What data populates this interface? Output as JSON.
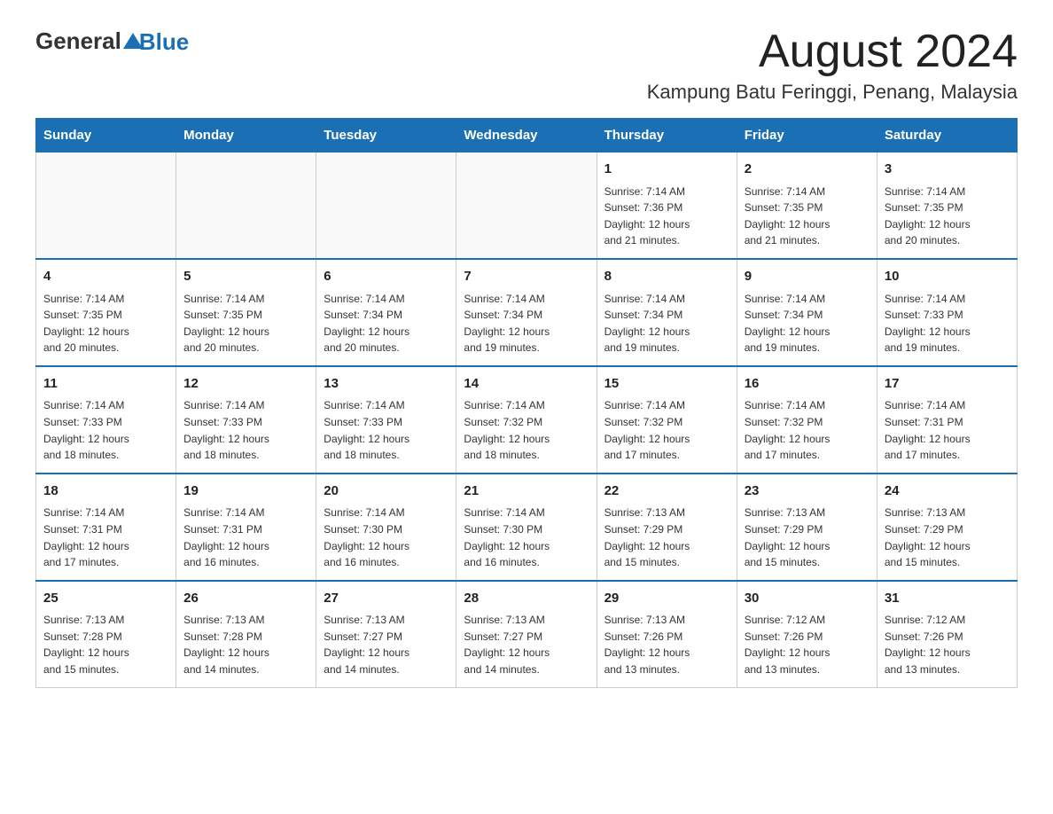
{
  "header": {
    "logo": {
      "text_general": "General",
      "text_blue": "Blue"
    },
    "month_year": "August 2024",
    "location": "Kampung Batu Feringgi, Penang, Malaysia"
  },
  "weekdays": [
    "Sunday",
    "Monday",
    "Tuesday",
    "Wednesday",
    "Thursday",
    "Friday",
    "Saturday"
  ],
  "weeks": [
    [
      {
        "day": "",
        "info": ""
      },
      {
        "day": "",
        "info": ""
      },
      {
        "day": "",
        "info": ""
      },
      {
        "day": "",
        "info": ""
      },
      {
        "day": "1",
        "info": "Sunrise: 7:14 AM\nSunset: 7:36 PM\nDaylight: 12 hours\nand 21 minutes."
      },
      {
        "day": "2",
        "info": "Sunrise: 7:14 AM\nSunset: 7:35 PM\nDaylight: 12 hours\nand 21 minutes."
      },
      {
        "day": "3",
        "info": "Sunrise: 7:14 AM\nSunset: 7:35 PM\nDaylight: 12 hours\nand 20 minutes."
      }
    ],
    [
      {
        "day": "4",
        "info": "Sunrise: 7:14 AM\nSunset: 7:35 PM\nDaylight: 12 hours\nand 20 minutes."
      },
      {
        "day": "5",
        "info": "Sunrise: 7:14 AM\nSunset: 7:35 PM\nDaylight: 12 hours\nand 20 minutes."
      },
      {
        "day": "6",
        "info": "Sunrise: 7:14 AM\nSunset: 7:34 PM\nDaylight: 12 hours\nand 20 minutes."
      },
      {
        "day": "7",
        "info": "Sunrise: 7:14 AM\nSunset: 7:34 PM\nDaylight: 12 hours\nand 19 minutes."
      },
      {
        "day": "8",
        "info": "Sunrise: 7:14 AM\nSunset: 7:34 PM\nDaylight: 12 hours\nand 19 minutes."
      },
      {
        "day": "9",
        "info": "Sunrise: 7:14 AM\nSunset: 7:34 PM\nDaylight: 12 hours\nand 19 minutes."
      },
      {
        "day": "10",
        "info": "Sunrise: 7:14 AM\nSunset: 7:33 PM\nDaylight: 12 hours\nand 19 minutes."
      }
    ],
    [
      {
        "day": "11",
        "info": "Sunrise: 7:14 AM\nSunset: 7:33 PM\nDaylight: 12 hours\nand 18 minutes."
      },
      {
        "day": "12",
        "info": "Sunrise: 7:14 AM\nSunset: 7:33 PM\nDaylight: 12 hours\nand 18 minutes."
      },
      {
        "day": "13",
        "info": "Sunrise: 7:14 AM\nSunset: 7:33 PM\nDaylight: 12 hours\nand 18 minutes."
      },
      {
        "day": "14",
        "info": "Sunrise: 7:14 AM\nSunset: 7:32 PM\nDaylight: 12 hours\nand 18 minutes."
      },
      {
        "day": "15",
        "info": "Sunrise: 7:14 AM\nSunset: 7:32 PM\nDaylight: 12 hours\nand 17 minutes."
      },
      {
        "day": "16",
        "info": "Sunrise: 7:14 AM\nSunset: 7:32 PM\nDaylight: 12 hours\nand 17 minutes."
      },
      {
        "day": "17",
        "info": "Sunrise: 7:14 AM\nSunset: 7:31 PM\nDaylight: 12 hours\nand 17 minutes."
      }
    ],
    [
      {
        "day": "18",
        "info": "Sunrise: 7:14 AM\nSunset: 7:31 PM\nDaylight: 12 hours\nand 17 minutes."
      },
      {
        "day": "19",
        "info": "Sunrise: 7:14 AM\nSunset: 7:31 PM\nDaylight: 12 hours\nand 16 minutes."
      },
      {
        "day": "20",
        "info": "Sunrise: 7:14 AM\nSunset: 7:30 PM\nDaylight: 12 hours\nand 16 minutes."
      },
      {
        "day": "21",
        "info": "Sunrise: 7:14 AM\nSunset: 7:30 PM\nDaylight: 12 hours\nand 16 minutes."
      },
      {
        "day": "22",
        "info": "Sunrise: 7:13 AM\nSunset: 7:29 PM\nDaylight: 12 hours\nand 15 minutes."
      },
      {
        "day": "23",
        "info": "Sunrise: 7:13 AM\nSunset: 7:29 PM\nDaylight: 12 hours\nand 15 minutes."
      },
      {
        "day": "24",
        "info": "Sunrise: 7:13 AM\nSunset: 7:29 PM\nDaylight: 12 hours\nand 15 minutes."
      }
    ],
    [
      {
        "day": "25",
        "info": "Sunrise: 7:13 AM\nSunset: 7:28 PM\nDaylight: 12 hours\nand 15 minutes."
      },
      {
        "day": "26",
        "info": "Sunrise: 7:13 AM\nSunset: 7:28 PM\nDaylight: 12 hours\nand 14 minutes."
      },
      {
        "day": "27",
        "info": "Sunrise: 7:13 AM\nSunset: 7:27 PM\nDaylight: 12 hours\nand 14 minutes."
      },
      {
        "day": "28",
        "info": "Sunrise: 7:13 AM\nSunset: 7:27 PM\nDaylight: 12 hours\nand 14 minutes."
      },
      {
        "day": "29",
        "info": "Sunrise: 7:13 AM\nSunset: 7:26 PM\nDaylight: 12 hours\nand 13 minutes."
      },
      {
        "day": "30",
        "info": "Sunrise: 7:12 AM\nSunset: 7:26 PM\nDaylight: 12 hours\nand 13 minutes."
      },
      {
        "day": "31",
        "info": "Sunrise: 7:12 AM\nSunset: 7:26 PM\nDaylight: 12 hours\nand 13 minutes."
      }
    ]
  ]
}
